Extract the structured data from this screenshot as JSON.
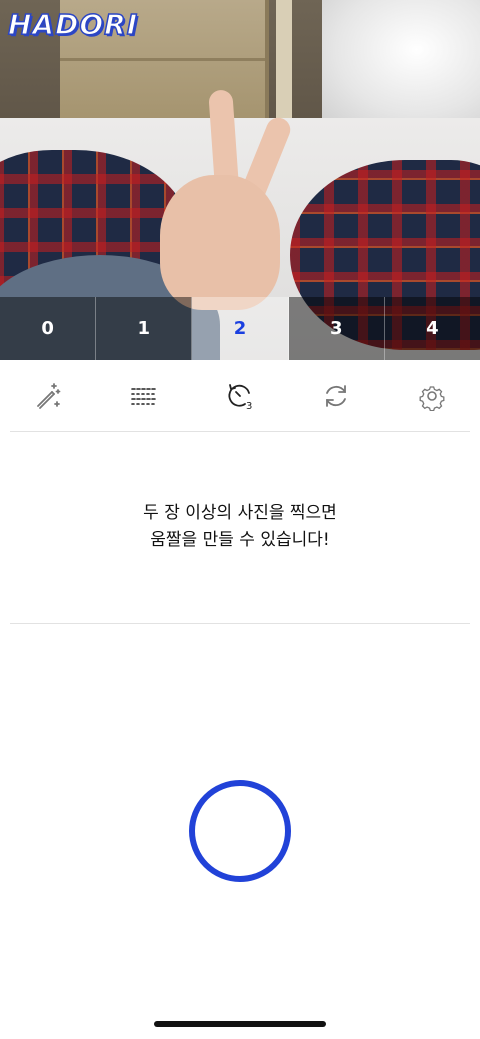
{
  "app": {
    "logo_text": "HADORI"
  },
  "frame_tabs": [
    {
      "label": "0",
      "active": false
    },
    {
      "label": "1",
      "active": false
    },
    {
      "label": "2",
      "active": true
    },
    {
      "label": "3",
      "active": false
    },
    {
      "label": "4",
      "active": false
    }
  ],
  "toolbar": {
    "items": [
      {
        "icon": "magic-wand-icon"
      },
      {
        "icon": "grid-pattern-icon"
      },
      {
        "icon": "timer-icon",
        "badge": "3"
      },
      {
        "icon": "switch-camera-icon"
      },
      {
        "icon": "gear-icon"
      }
    ]
  },
  "message": {
    "line1": "두 장 이상의 사진을 찍으면",
    "line2": "움짤을 만들 수 있습니다!"
  },
  "colors": {
    "accent": "#2142d8"
  }
}
